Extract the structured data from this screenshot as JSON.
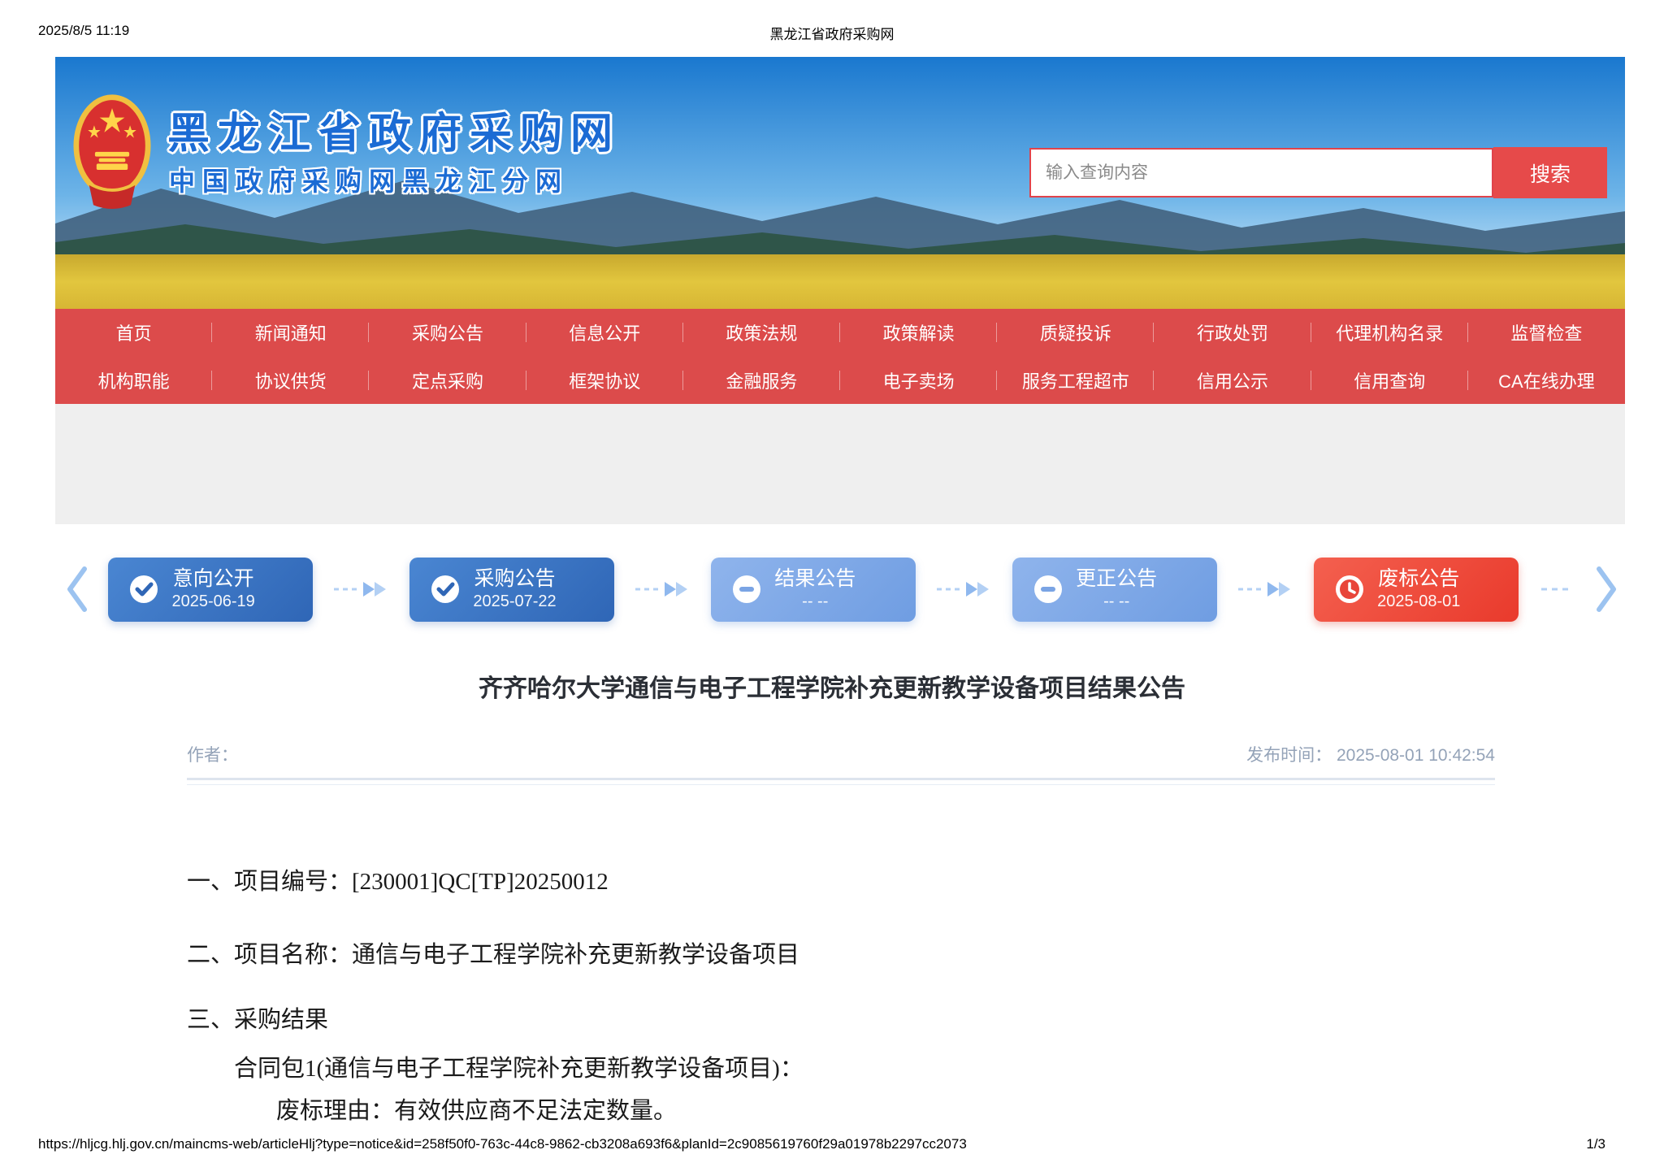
{
  "print_header": {
    "datetime": "2025/8/5 11:19",
    "title": "黑龙江省政府采购网"
  },
  "banner": {
    "site_title": "黑龙江省政府采购网",
    "site_subtitle": "中国政府采购网黑龙江分网",
    "search_placeholder": "输入查询内容",
    "search_button_label": "搜索"
  },
  "nav": {
    "row1": [
      "首页",
      "新闻通知",
      "采购公告",
      "信息公开",
      "政策法规",
      "政策解读",
      "质疑投诉",
      "行政处罚",
      "代理机构名录",
      "监督检查"
    ],
    "row2": [
      "机构职能",
      "协议供货",
      "定点采购",
      "框架协议",
      "金融服务",
      "电子卖场",
      "服务工程超市",
      "信用公示",
      "信用查询",
      "CA在线办理"
    ]
  },
  "timeline": {
    "steps": [
      {
        "label": "意向公开",
        "date": "2025-06-19",
        "state": "done",
        "icon": "check-circle-icon"
      },
      {
        "label": "采购公告",
        "date": "2025-07-22",
        "state": "done",
        "icon": "check-circle-icon"
      },
      {
        "label": "结果公告",
        "date": "-- --",
        "state": "pending",
        "icon": "minus-circle-icon"
      },
      {
        "label": "更正公告",
        "date": "-- --",
        "state": "pending",
        "icon": "minus-circle-icon"
      },
      {
        "label": "废标公告",
        "date": "2025-08-01",
        "state": "alert",
        "icon": "clock-icon"
      }
    ]
  },
  "article": {
    "title": "齐齐哈尔大学通信与电子工程学院补充更新教学设备项目结果公告",
    "author_label": "作者：",
    "publish_text": "发布时间： 2025-08-01 10:42:54",
    "paragraphs": [
      "一、项目编号：[230001]QC[TP]20250012",
      "二、项目名称：通信与电子工程学院补充更新教学设备项目",
      "三、采购结果",
      "合同包1(通信与电子工程学院补充更新教学设备项目)：",
      "废标理由：有效供应商不足法定数量。"
    ]
  },
  "print_footer": {
    "url": "https://hljcg.hlj.gov.cn/maincms-web/articleHlj?type=notice&id=258f50f0-763c-44c8-9862-cb3208a693f6&planId=2c9085619760f29a01978b2297cc2073",
    "page": "1/3"
  },
  "colors": {
    "nav_red": "#dc4b4b",
    "search_button_red": "#e64a4a",
    "step_done_blue": "#2f66b6",
    "step_pending_blue": "#7aa4e4",
    "step_alert_red": "#e93a2c",
    "banner_title_blue": "#1b6bd4",
    "meta_gray_blue": "#94a3b8"
  }
}
